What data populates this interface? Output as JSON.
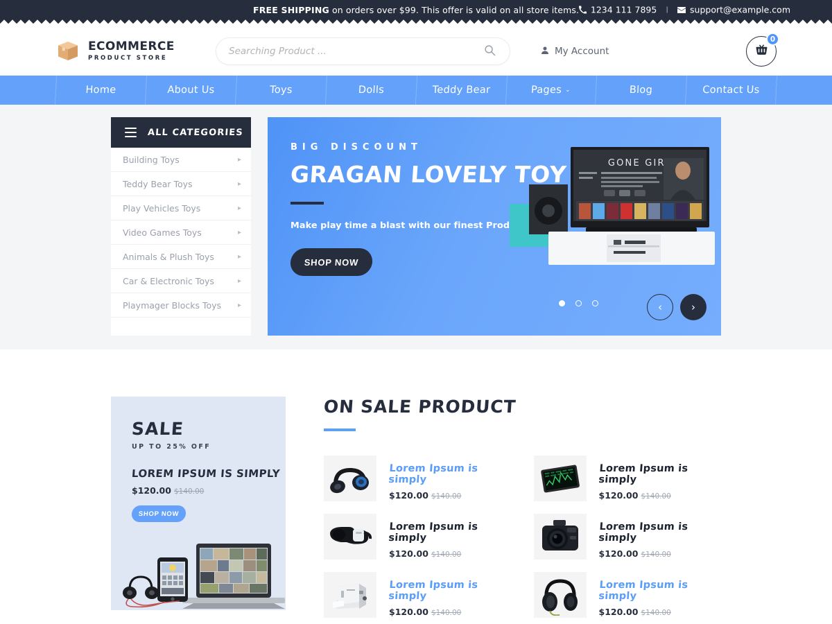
{
  "topbar": {
    "shipping_bold": "FREE SHIPPING",
    "shipping_rest": " on orders over $99. This offer is valid on all store items.",
    "phone": "1234 111 7895",
    "separator": "I",
    "email": "support@example.com",
    "bg_color": "#262d3d"
  },
  "header": {
    "logo_line1": "ECOMMERCE",
    "logo_line2": "PRODUCT STORE",
    "search_placeholder": "Searching Product ...",
    "search_value": "",
    "account_label": "My Account",
    "cart_count": "0",
    "cart_badge_color": "#4f96f6"
  },
  "nav": {
    "bg_color": "#63a1fb",
    "items": [
      {
        "label": "Home",
        "caret": ""
      },
      {
        "label": "About Us",
        "caret": ""
      },
      {
        "label": "Toys",
        "caret": ""
      },
      {
        "label": "Dolls",
        "caret": ""
      },
      {
        "label": "Teddy Bear",
        "caret": ""
      },
      {
        "label": "Pages",
        "caret": "⌄"
      },
      {
        "label": "Blog",
        "caret": ""
      },
      {
        "label": "Contact Us",
        "caret": ""
      }
    ]
  },
  "categories": {
    "title": "ALL CATEGORIES",
    "items": [
      {
        "label": "Building Toys"
      },
      {
        "label": "Teddy Bear  Toys"
      },
      {
        "label": "Play Vehicles  Toys"
      },
      {
        "label": "Video Games  Toys"
      },
      {
        "label": "Animals & Plush Toys"
      },
      {
        "label": "Car & Electronic Toys"
      },
      {
        "label": "Playmager Blocks Toys"
      }
    ]
  },
  "hero": {
    "eyebrow": "BIG DISCOUNT",
    "title": "GRAGAN LOVELY TOY",
    "subtitle": "Make play time a blast with our finest Productsz",
    "cta": "SHOP NOW",
    "bg_color": "#63a1fb",
    "media_caption": "GONE GIRL",
    "dots": 3,
    "active_dot": 1,
    "prev_label": "‹",
    "next_label": "›"
  },
  "sale_banner": {
    "heading": "SALE",
    "subheading": "UP TO 25% OFF",
    "product_name": "LOREM IPSUM IS SIMPLY",
    "price": "$120.00",
    "old_price": "$140.00",
    "cta": "SHOP NOW",
    "bg_color": "#dfe7f4"
  },
  "on_sale": {
    "section_title": "ON SALE PRODUCT",
    "accent_color": "#5f9ef5",
    "products": [
      {
        "name": "Lorem Ipsum is simply",
        "price": "$120.00",
        "old_price": "$140.00",
        "style": "blue",
        "image": "headphones-blue"
      },
      {
        "name": "Lorem Ipsum is simply",
        "price": "$120.00",
        "old_price": "$140.00",
        "style": "dark",
        "image": "graphics-tablet"
      },
      {
        "name": "Lorem Ipsum is simply",
        "price": "$120.00",
        "old_price": "$140.00",
        "style": "dark",
        "image": "vr-headset"
      },
      {
        "name": "Lorem Ipsum is simply",
        "price": "$120.00",
        "old_price": "$140.00",
        "style": "dark",
        "image": "dslr-camera"
      },
      {
        "name": "Lorem Ipsum is simply",
        "price": "$120.00",
        "old_price": "$140.00",
        "style": "blue",
        "image": "printer"
      },
      {
        "name": "Lorem Ipsum is simply",
        "price": "$120.00",
        "old_price": "$140.00",
        "style": "blue",
        "image": "studio-headphones"
      }
    ]
  }
}
